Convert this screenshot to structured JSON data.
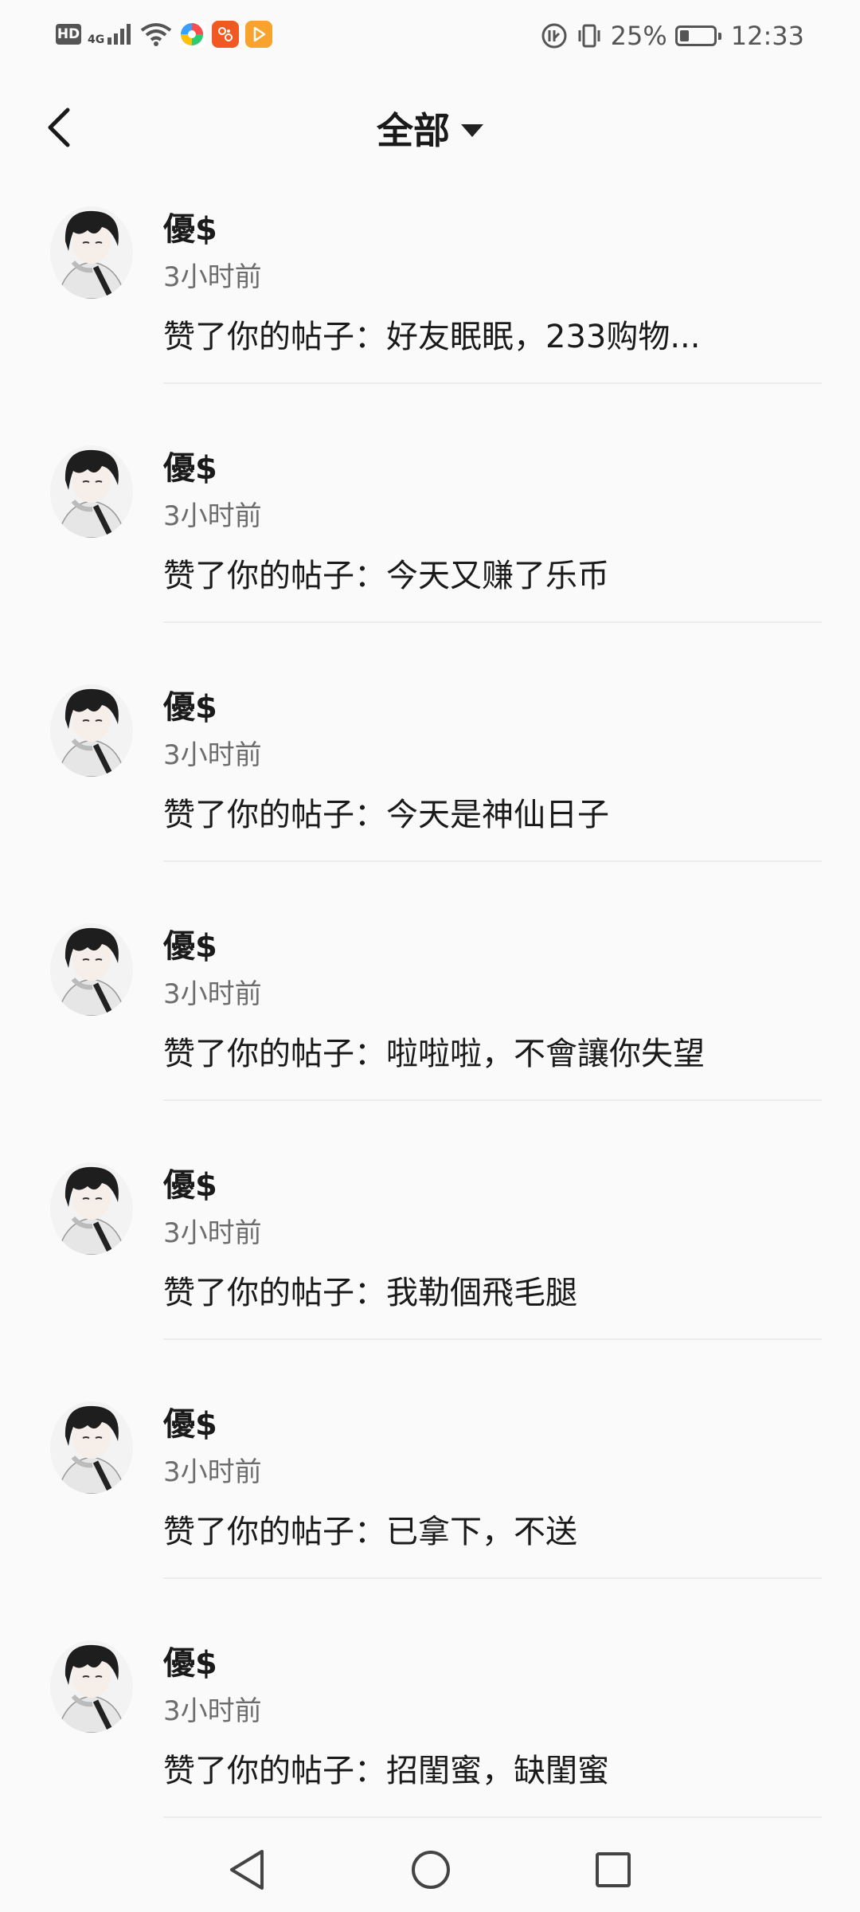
{
  "status_bar": {
    "hd": "HD",
    "network": "4G",
    "battery_percent": "25%",
    "time": "12:33",
    "apps": [
      "colorful-ball-app-icon",
      "orange-app-icon",
      "orange-play-app-icon"
    ]
  },
  "header": {
    "title": "全部"
  },
  "notifications": [
    {
      "name": "優$",
      "time": "3小时前",
      "content": "赞了你的帖子：好友眠眠，233购物..."
    },
    {
      "name": "優$",
      "time": "3小时前",
      "content": "赞了你的帖子：今天又赚了乐币"
    },
    {
      "name": "優$",
      "time": "3小时前",
      "content": "赞了你的帖子：今天是神仙日子"
    },
    {
      "name": "優$",
      "time": "3小时前",
      "content": "赞了你的帖子：啦啦啦，不會讓你失望"
    },
    {
      "name": "優$",
      "time": "3小时前",
      "content": "赞了你的帖子：我勒個飛毛腿"
    },
    {
      "name": "優$",
      "time": "3小时前",
      "content": "赞了你的帖子：已拿下，不送"
    },
    {
      "name": "優$",
      "time": "3小时前",
      "content": "赞了你的帖子：招閨蜜，缺閨蜜"
    }
  ],
  "colors": {
    "background": "#fbfafb",
    "text": "#1a1a1a",
    "secondary_text": "#6d6d6d",
    "divider": "#ececec"
  }
}
